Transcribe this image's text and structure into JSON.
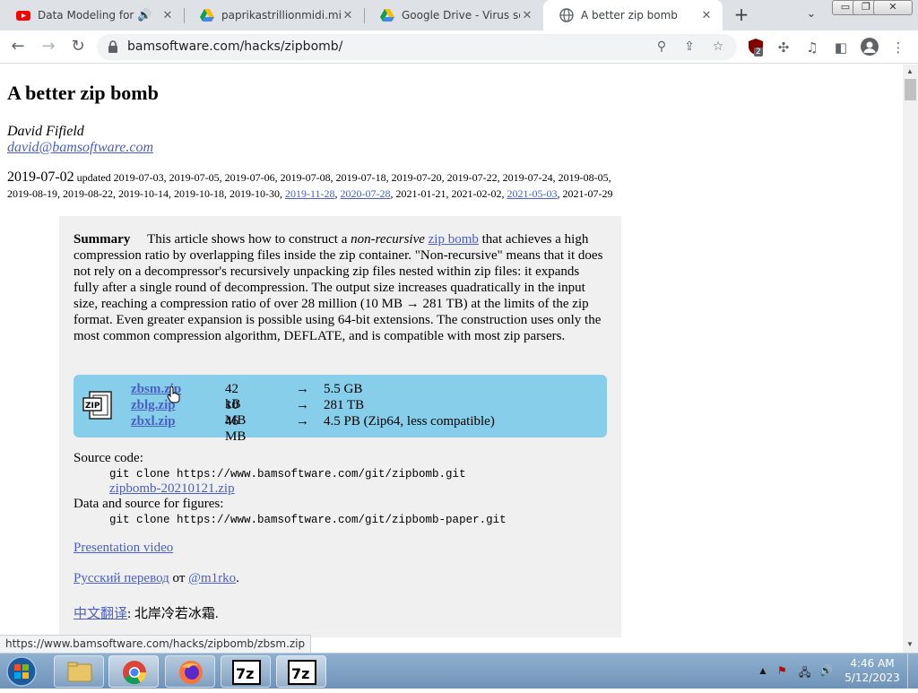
{
  "window": {
    "minimize": "▭",
    "restore": "❐",
    "close": "✕"
  },
  "tabs": [
    {
      "title": "Data Modeling for Power BI",
      "icon": "youtube-icon",
      "close": "🔊"
    },
    {
      "title": "paprikastrillionmidi.mid.xlsx",
      "icon": "google-drive-icon",
      "close": "✕"
    },
    {
      "title": "Google Drive - Virus scan warning",
      "icon": "google-drive-icon",
      "close": "✕"
    },
    {
      "title": "A better zip bomb",
      "icon": "globe-icon",
      "close": "✕"
    }
  ],
  "toolbar": {
    "back": "←",
    "forward": "→",
    "reload": "↻",
    "url": "bamsoftware.com/hacks/zipbomb/",
    "extension_badge": "2",
    "menu": "⋮"
  },
  "page": {
    "title": "A better zip bomb",
    "author": "David Fifield",
    "email": "david@bamsoftware.com",
    "date_first": "2019-07-02",
    "dates_line1": " updated 2019-07-03, 2019-07-05, 2019-07-06, 2019-07-08, 2019-07-18, 2019-07-20, 2019-07-22, 2019-07-24, 2019-08-05,",
    "dates_line2_a": "2019-08-19, 2019-08-22, 2019-10-14, 2019-10-18, 2019-10-30, ",
    "dates_link1": "2019-11-28",
    "dates_sep1": ", ",
    "dates_link2": "2020-07-28",
    "dates_line2_b": ", 2021-01-21, 2021-02-02, ",
    "dates_link3": "2021-05-03",
    "dates_line2_c": ", 2021-07-29",
    "summary_label": "Summary",
    "summary_1": "This article shows how to construct a ",
    "summary_em": "non-recursive",
    "summary_link": "zip bomb",
    "summary_2": " that achieves a high compression ratio by overlapping files inside the zip container. \"Non-recursive\" means that it does not rely on a decompressor's recursively unpacking zip files nested within zip files: it expands fully after a single round of decompression. The output size increases quadratically in the input size, reaching a compression ratio of over 28 million (10 MB → 281 TB) at the limits of the zip format. Even greater expansion is possible using 64-bit extensions. The construction uses only the most common compression algorithm, DEFLATE, and is compatible with most zip parsers.",
    "downloads": [
      {
        "name": "zbsm.zip",
        "size": "42 kB",
        "arrow": "→",
        "out": "5.5 GB"
      },
      {
        "name": "zblg.zip",
        "size": "10 MB",
        "arrow": "→",
        "out": "281 TB"
      },
      {
        "name": "zbxl.zip",
        "size": "46 MB",
        "arrow": "→",
        "out": "4.5 PB (Zip64, less compatible)"
      }
    ],
    "source_label": "Source code:",
    "source_git": "git clone https://www.bamsoftware.com/git/zipbomb.git",
    "source_zip": "zipbomb-20210121.zip",
    "figures_label": "Data and source for figures:",
    "figures_git": "git clone https://www.bamsoftware.com/git/zipbomb-paper.git",
    "video": "Presentation video",
    "ru_link": "Русский перевод",
    "ru_from": " от ",
    "ru_user": "@m1rko",
    "ru_end": ".",
    "zh_link": "中文翻译",
    "zh_rest": ": 北岸冷若冰霜."
  },
  "status_url": "https://www.bamsoftware.com/hacks/zipbomb/zbsm.zip",
  "taskbar": {
    "time": "4:46 AM",
    "date": "5/12/2023"
  },
  "colors": {
    "link": "#4a5fc1",
    "download_bg": "#87ceeb",
    "summary_bg": "#f0f0f0"
  }
}
